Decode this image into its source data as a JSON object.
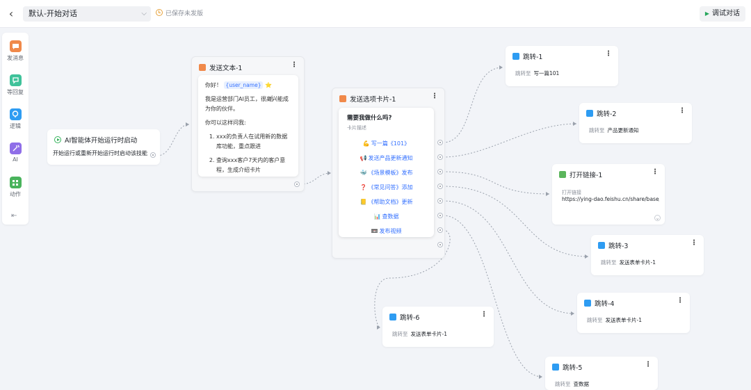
{
  "topbar": {
    "back_icon": "chevron-left-icon",
    "flow_name": "默认-开始对话",
    "save_status": "已保存未发版",
    "debug_label": "调试对话"
  },
  "sidebar": {
    "items": [
      {
        "label": "发消息",
        "icon": "message-icon",
        "color": "#f0894a"
      },
      {
        "label": "等回复",
        "icon": "reply-icon",
        "color": "#3fc29a"
      },
      {
        "label": "逻辑",
        "icon": "logic-icon",
        "color": "#2e9cf2"
      },
      {
        "label": "AI",
        "icon": "ai-wand-icon",
        "color": "#8f6ee8"
      },
      {
        "label": "动作",
        "icon": "action-grid-icon",
        "color": "#49b35c"
      }
    ],
    "collapse_icon": "collapse-icon"
  },
  "start_node": {
    "title": "AI智能体开始运行时启动",
    "desc": "开始运行或重新开始运行时启动该技能",
    "color": "#34b35a"
  },
  "send_text": {
    "title": "发送文本-1",
    "greeting": "你好！",
    "variable": "{user_name}",
    "star": "⭐",
    "intro": "我是运营部门AI员工，很高兴能成为你的伙伴。",
    "prompt": "你可以这样问我:",
    "items": [
      "xxx的负责人在试用新的数据库功能，重点跟进",
      "查询xxx客户7天内的客户意程，生成介绍卡片"
    ],
    "color": "#f0894a"
  },
  "option_card": {
    "title": "发送选项卡片-1",
    "question": "需要我做什么吗?",
    "desc": "卡片描述",
    "options": [
      {
        "emoji": "💪",
        "text": "写一篇《101》"
      },
      {
        "emoji": "📢",
        "text": "发送产品更新通知"
      },
      {
        "emoji": "🐳",
        "text": "《场景模板》发布"
      },
      {
        "emoji": "❓",
        "text": "《常见问答》添加"
      },
      {
        "emoji": "📒",
        "text": "《帮助文档》更新"
      },
      {
        "emoji": "📊",
        "text": "查数据"
      },
      {
        "emoji": "📼",
        "text": "发布视频"
      }
    ],
    "color": "#f0894a"
  },
  "jump_label": "跳转至",
  "jumps": [
    {
      "title": "跳转-1",
      "target": "写一篇101"
    },
    {
      "title": "跳转-2",
      "target": "产品更新通知"
    },
    {
      "title": "跳转-3",
      "target": "发送表单卡片-1"
    },
    {
      "title": "跳转-4",
      "target": "发送表单卡片-1"
    },
    {
      "title": "跳转-5",
      "target": "查数据"
    },
    {
      "title": "跳转-6",
      "target": "发送表单卡片-1"
    }
  ],
  "open_link": {
    "title": "打开链接-1",
    "label": "打开链接",
    "url": "https://ying-dao.feishu.cn/share/base/for",
    "color": "#5bb55c"
  },
  "colors": {
    "jump": "#2e9cf2",
    "edge": "#9aa1ac",
    "link": "#3370ff"
  }
}
